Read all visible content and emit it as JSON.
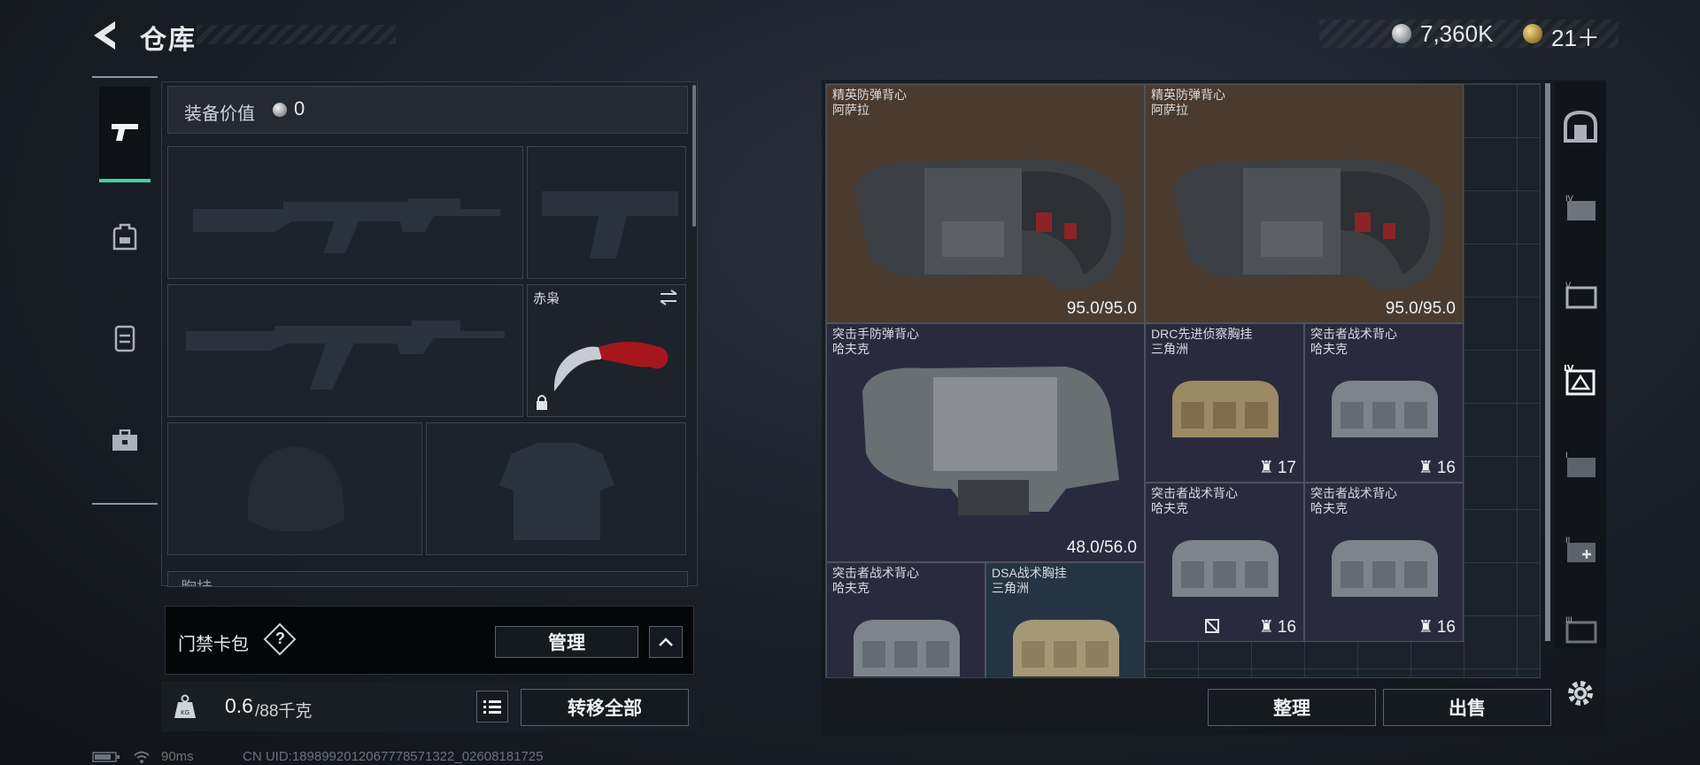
{
  "header": {
    "title": "仓库",
    "currency_silver": "7,360K",
    "currency_gold": "21＋"
  },
  "tabs": [
    {
      "icon": "pistol-icon",
      "active": true
    },
    {
      "icon": "backpack-icon",
      "active": false
    },
    {
      "icon": "vest-icon",
      "active": false
    },
    {
      "icon": "toolbox-icon",
      "active": false
    }
  ],
  "equipment": {
    "value_label": "装备价值",
    "value": "0",
    "melee_name": "赤枭",
    "next_section_label": "胸挂"
  },
  "keycard": {
    "label": "门禁卡包",
    "help": "?",
    "manage_label": "管理"
  },
  "weight": {
    "current": "0.6",
    "max": "/88千克",
    "transfer_all_label": "转移全部"
  },
  "stash": {
    "items": [
      {
        "name": "精英防弹背心",
        "sub": "阿萨拉",
        "durability": "95.0/95.0"
      },
      {
        "name": "精英防弹背心",
        "sub": "阿萨拉",
        "durability": "95.0/95.0"
      },
      {
        "name": "突击手防弹背心",
        "sub": "哈夫克",
        "durability": "48.0/56.0"
      },
      {
        "name": "DRC先进侦察胸挂",
        "sub": "三角洲",
        "stack": "17"
      },
      {
        "name": "突击者战术背心",
        "sub": "哈夫克",
        "stack": "16"
      },
      {
        "name": "突击者战术背心",
        "sub": "哈夫克",
        "stack": "16"
      },
      {
        "name": "突击者战术背心",
        "sub": "哈夫克",
        "stack": "16"
      },
      {
        "name": "突击者战术背心",
        "sub": "哈夫克",
        "stack": ""
      },
      {
        "name": "DSA战术胸挂",
        "sub": "三角洲",
        "stack": ""
      }
    ],
    "sort_label": "整理",
    "sell_label": "出售"
  },
  "status": {
    "ping": "90ms",
    "uid": "CN UID:1898992012067778571322_02608181725"
  },
  "colors": {
    "accent": "#3fd39a",
    "gold_rarity": "#4a3b2e",
    "purple_rarity": "#2a2a3f",
    "blue_rarity": "#253442"
  }
}
